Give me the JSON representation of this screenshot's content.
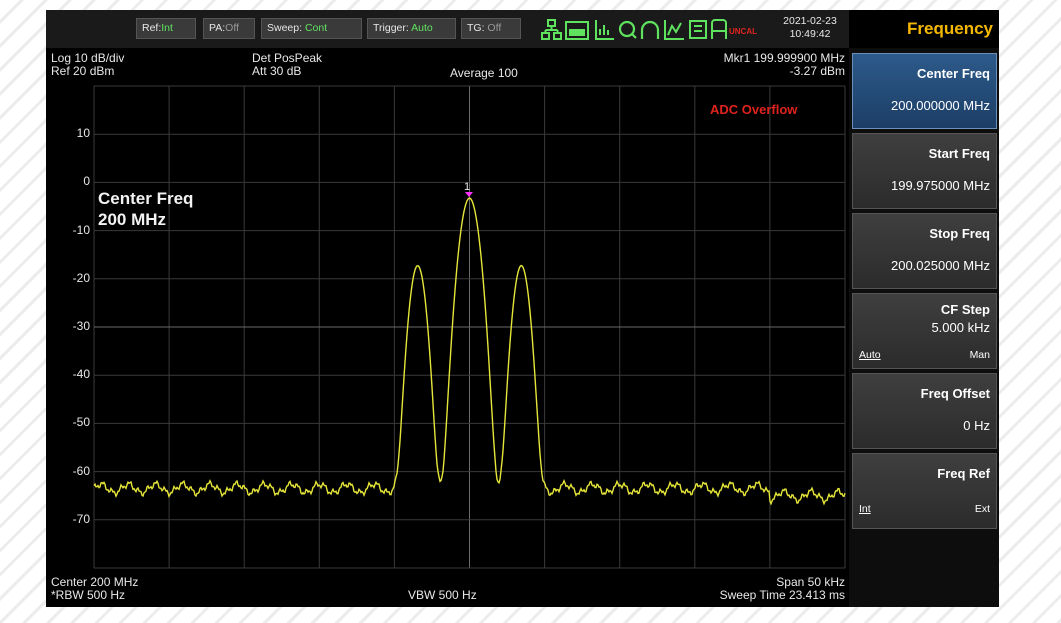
{
  "status_bar": {
    "ref": {
      "label": "Ref:",
      "value": "Int"
    },
    "pa": {
      "label": "PA:",
      "value": "Off"
    },
    "sweep": {
      "label": "Sweep:",
      "value": "Cont"
    },
    "trigger": {
      "label": "Trigger:",
      "value": "Auto"
    },
    "tg": {
      "label": "TG:",
      "value": "Off"
    },
    "uncal": "UNCAL",
    "date": "2021-02-23",
    "time": "10:49:42",
    "icons": [
      "network-icon",
      "speed-icon",
      "fft-icon",
      "search-icon",
      "trace-hold-icon",
      "measure-icon",
      "mute-icon",
      "battery-icon"
    ]
  },
  "measurement": {
    "scale": "Log 10 dB/div",
    "ref_level": "Ref 20 dBm",
    "detector": "Det PosPeak",
    "attenuation": "Att 30 dB",
    "average": "Average 100",
    "marker_label": "Mkr1  199.999900 MHz",
    "marker_level": "-3.27 dBm",
    "marker_number": "1",
    "adc_warning": "ADC Overflow",
    "annotation_line1": "Center Freq",
    "annotation_line2": "200 MHz",
    "center": "Center 200 MHz",
    "rbw": "*RBW 500 Hz",
    "vbw": "VBW 500 Hz",
    "span": "Span 50 kHz",
    "sweep_time": "Sweep Time 23.413 ms"
  },
  "y_ticks": [
    "10",
    "0",
    "-10",
    "-20",
    "-30",
    "-40",
    "-50",
    "-60",
    "-70"
  ],
  "colors": {
    "trace": "#e6e63a",
    "menu_title": "#f5b800",
    "marker": "#ff33ff",
    "warning": "#e0231c",
    "active_value": "#5fe35f"
  },
  "menu": {
    "title": "Frequency",
    "center_freq": {
      "label": "Center Freq",
      "value": "200.000000 MHz"
    },
    "start_freq": {
      "label": "Start Freq",
      "value": "199.975000 MHz"
    },
    "stop_freq": {
      "label": "Stop Freq",
      "value": "200.025000 MHz"
    },
    "cf_step": {
      "label": "CF Step",
      "value": "5.000 kHz",
      "opt_left": "Auto",
      "opt_right": "Man"
    },
    "freq_offset": {
      "label": "Freq Offset",
      "value": "0 Hz"
    },
    "freq_ref": {
      "label": "Freq Ref",
      "opt_left": "Int",
      "opt_right": "Ext"
    }
  }
}
